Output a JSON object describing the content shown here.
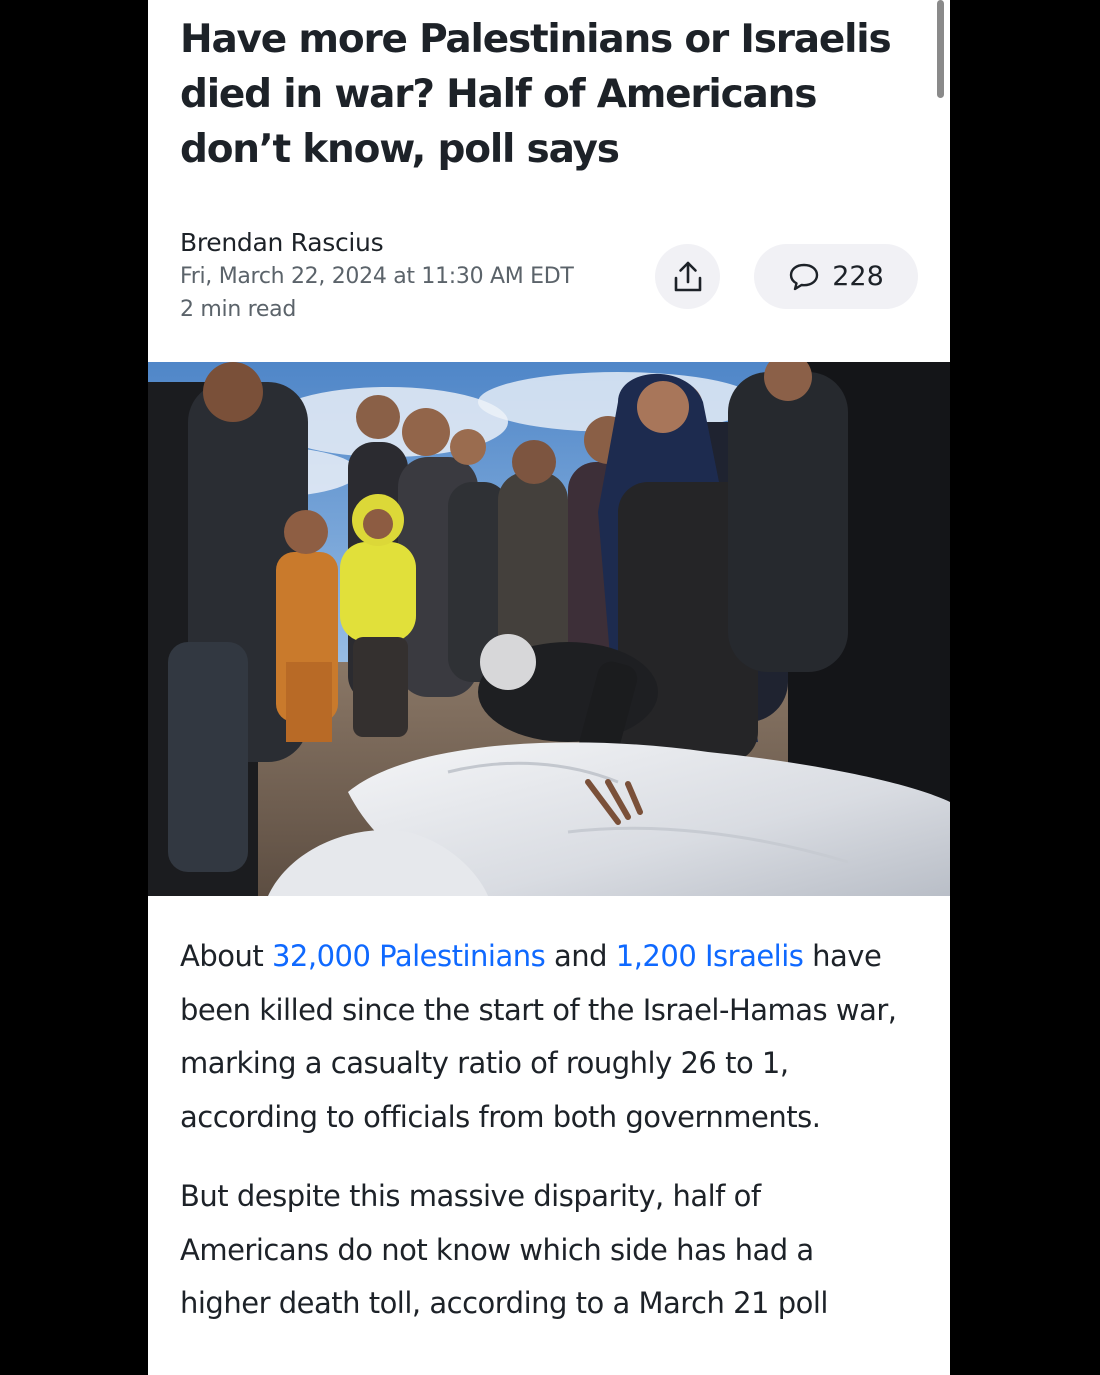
{
  "article": {
    "headline": "Have more Palestinians or Israelis died in war? Half of Americans don’t know, poll says",
    "author": "Brendan Rascius",
    "date": "Fri, March 22, 2024 at 11:30 AM EDT",
    "read_time": "2 min read"
  },
  "actions": {
    "share_icon": "share-icon",
    "comment_icon": "comment-bubble-icon",
    "comment_count": "228"
  },
  "body": {
    "p1_prefix": "About ",
    "p1_link1": "32,000 Palestinians",
    "p1_and": " and ",
    "p1_link2": "1,200 Israelis",
    "p1_rest": " have been killed since the start of the Israel-Hamas war, marking a casualty ratio of roughly 26 to 1, according to officials from both governments.",
    "p2": "But despite this massive disparity, half of Americans do not know which side has had a higher death toll, according to a March 21 poll"
  },
  "colors": {
    "link": "#0f69ff",
    "text": "#1d2228",
    "muted": "#5b636a",
    "pill_bg": "#f1f1f5"
  }
}
